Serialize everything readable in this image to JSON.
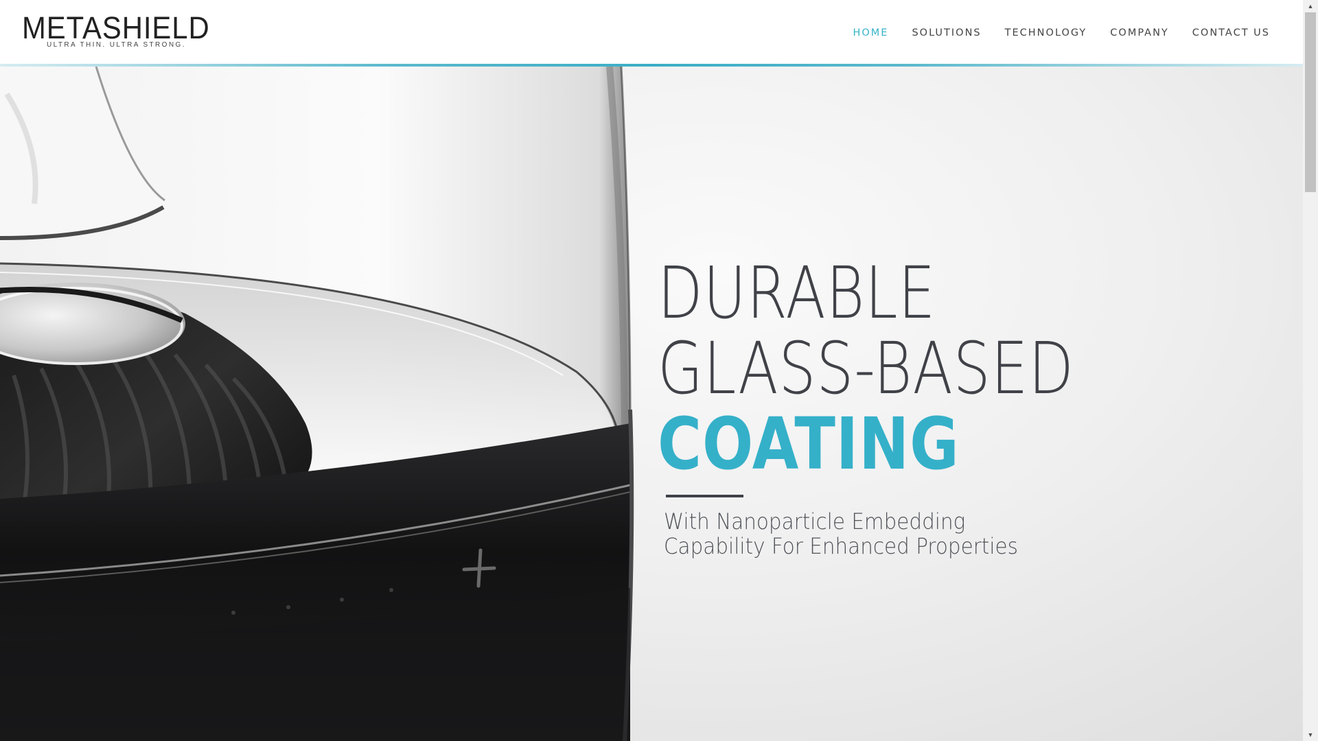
{
  "brand": {
    "name": "METASHIELD",
    "tagline": "ULTRA THIN. ULTRA STRONG."
  },
  "nav": {
    "items": [
      {
        "label": "HOME",
        "active": true
      },
      {
        "label": "SOLUTIONS",
        "active": false
      },
      {
        "label": "TECHNOLOGY",
        "active": false
      },
      {
        "label": "COMPANY",
        "active": false
      },
      {
        "label": "CONTACT US",
        "active": false
      }
    ]
  },
  "hero": {
    "line1": "DURABLE",
    "line2": "GLASS-BASED",
    "line3": "COATING",
    "sub_line1": "With Nanoparticle Embedding",
    "sub_line2": "Capability For Enhanced Properties"
  },
  "colors": {
    "accent": "#35b0c9",
    "heading": "#404248",
    "nav_text": "#444444"
  },
  "icons": {
    "scroll_up": "triangle-up",
    "scroll_down": "triangle-down"
  }
}
